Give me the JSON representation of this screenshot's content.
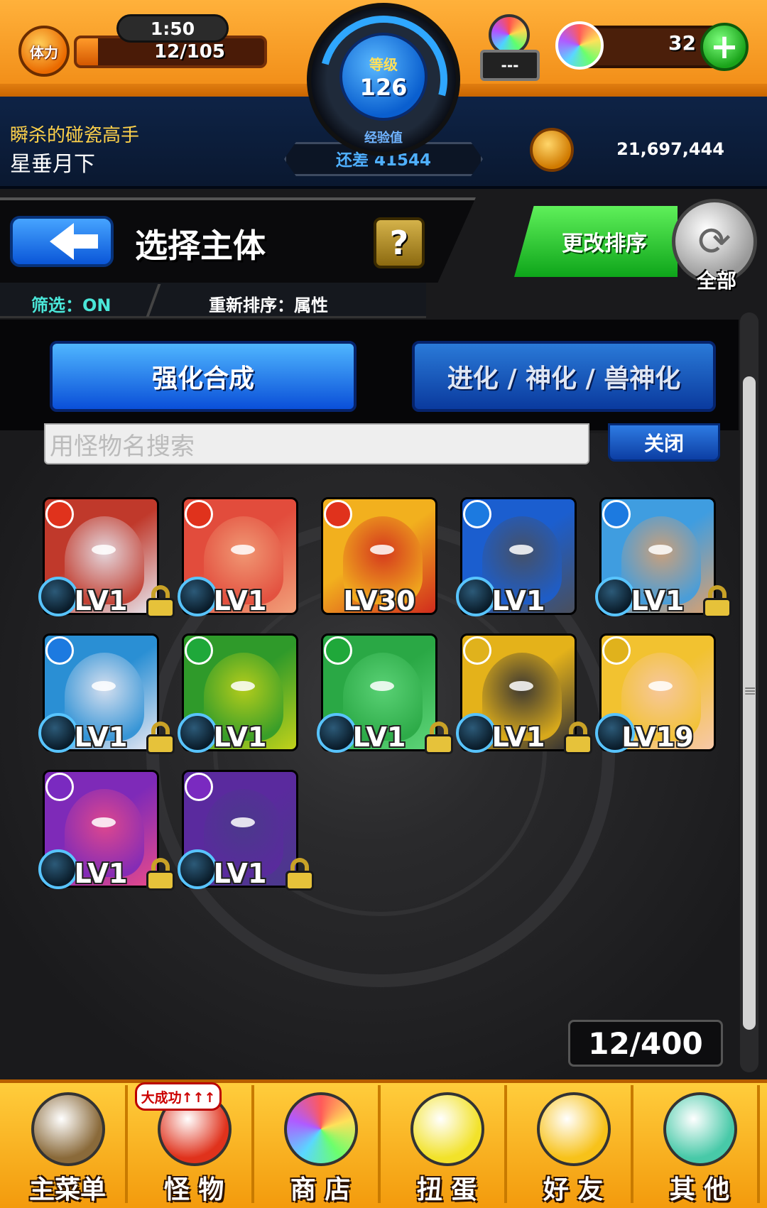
{
  "hud": {
    "stamina_icon_label": "体力",
    "stamina_timer": "1:50",
    "stamina_count": "12/105",
    "stamina_fraction": 0.114,
    "level_label": "等级",
    "level_value": "126",
    "badge_box": "---",
    "orb_count": "32",
    "plus_label": "+",
    "colors": {
      "hud_orange": "#f08a14",
      "plus_green": "#1aa31a",
      "level_blue": "#0a5fcf"
    }
  },
  "player": {
    "title": "瞬杀的碰瓷高手",
    "name": "星垂月下",
    "exp_label": "经验值",
    "exp_remaining": "还差 41544",
    "coins": "21,697,444"
  },
  "header": {
    "title": "选择主体",
    "help_label": "?",
    "filter_status": "筛选：ON",
    "sort_status": "重新排序：属性",
    "sort_button": "更改排序",
    "refresh_label": "全部",
    "refresh_glyph": "⟳"
  },
  "tabs": [
    {
      "label": "强化合成",
      "active": true
    },
    {
      "label": "进化 / 神化 / 兽神化",
      "active": false
    }
  ],
  "search": {
    "placeholder": "用怪物名搜索",
    "close_label": "关闭"
  },
  "monsters": [
    {
      "level": "LV1",
      "element": "fire",
      "locked": true,
      "palette": [
        "#c0392b",
        "#e8e8f0"
      ]
    },
    {
      "level": "LV1",
      "element": "fire",
      "locked": false,
      "palette": [
        "#e24c3c",
        "#f2a07a"
      ]
    },
    {
      "level": "LV30",
      "element": "fire",
      "locked": false,
      "palette": [
        "#f2b01e",
        "#d12b1d"
      ]
    },
    {
      "level": "LV1",
      "element": "water",
      "locked": false,
      "palette": [
        "#1b5ecf",
        "#4a4f5c"
      ]
    },
    {
      "level": "LV1",
      "element": "water",
      "locked": true,
      "palette": [
        "#3f9de0",
        "#d9a070"
      ]
    },
    {
      "level": "LV1",
      "element": "water",
      "locked": true,
      "palette": [
        "#2a8fd4",
        "#e8e8f2"
      ]
    },
    {
      "level": "LV1",
      "element": "wood",
      "locked": false,
      "palette": [
        "#2f9a2a",
        "#c2d21a"
      ]
    },
    {
      "level": "LV1",
      "element": "wood",
      "locked": true,
      "palette": [
        "#2aa845",
        "#5fd67a"
      ]
    },
    {
      "level": "LV1",
      "element": "light",
      "locked": true,
      "palette": [
        "#e4b21a",
        "#2c2c34"
      ]
    },
    {
      "level": "LV19",
      "element": "light",
      "locked": false,
      "palette": [
        "#f2c230",
        "#f7c8a8"
      ]
    },
    {
      "level": "LV1",
      "element": "dark",
      "locked": true,
      "palette": [
        "#7e2ab8",
        "#e84a8a"
      ]
    },
    {
      "level": "LV1",
      "element": "dark",
      "locked": true,
      "palette": [
        "#5a2a9e",
        "#4a3a8a"
      ]
    }
  ],
  "element_colors": {
    "fire": "#e0321c",
    "water": "#1c7ae0",
    "wood": "#1fa83a",
    "light": "#e0b21c",
    "dark": "#7a2ac0"
  },
  "box_count": "12/400",
  "nav": {
    "badge": "大成功↑↑↑",
    "items": [
      {
        "label": "主菜单",
        "icon": "gate-icon",
        "color": "#8a6a3a"
      },
      {
        "label": "怪 物",
        "icon": "monster-icon",
        "color": "#e0321c"
      },
      {
        "label": "商 店",
        "icon": "orb-icon",
        "color": "#b9e3ff"
      },
      {
        "label": "扭 蛋",
        "icon": "egg-icon",
        "color": "#f2e22a"
      },
      {
        "label": "好 友",
        "icon": "friends-icon",
        "color": "#f7c21a"
      },
      {
        "label": "其 他",
        "icon": "other-icon",
        "color": "#48c9a8"
      }
    ]
  }
}
